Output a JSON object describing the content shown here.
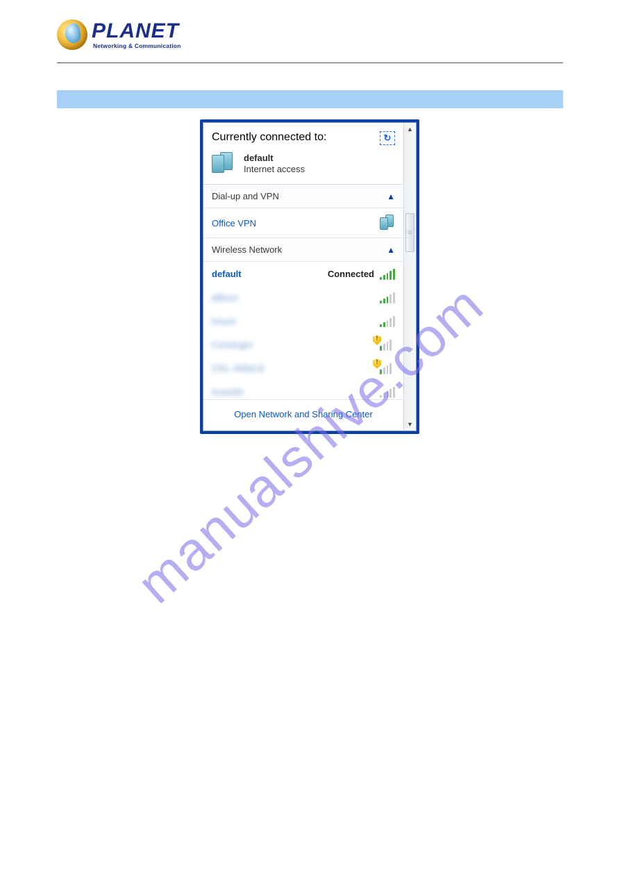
{
  "brand": {
    "name": "PLANET",
    "tagline": "Networking & Communication"
  },
  "watermark": "manualshive.com",
  "flyout": {
    "headerLabel": "Currently connected to:",
    "connection": {
      "name": "default",
      "status": "Internet access"
    },
    "sections": {
      "vpn": {
        "label": "Dial-up and VPN",
        "items": [
          {
            "name": "Office VPN"
          }
        ]
      },
      "wireless": {
        "label": "Wireless Network",
        "items": [
          {
            "name": "default",
            "status": "Connected",
            "signal": 5,
            "warn": false,
            "blurred": false
          },
          {
            "name": "aBssn",
            "status": "",
            "signal": 3,
            "warn": false,
            "blurred": true
          },
          {
            "name": "houst",
            "status": "",
            "signal": 2,
            "warn": false,
            "blurred": true
          },
          {
            "name": "Comlogin",
            "status": "",
            "signal": 2,
            "warn": true,
            "blurred": true
          },
          {
            "name": "CKL-486d-E",
            "status": "",
            "signal": 2,
            "warn": true,
            "blurred": true
          },
          {
            "name": "Insetdn",
            "status": "",
            "signal": 0,
            "warn": false,
            "blurred": true
          }
        ]
      }
    },
    "footerLink": "Open Network and Sharing Center"
  }
}
